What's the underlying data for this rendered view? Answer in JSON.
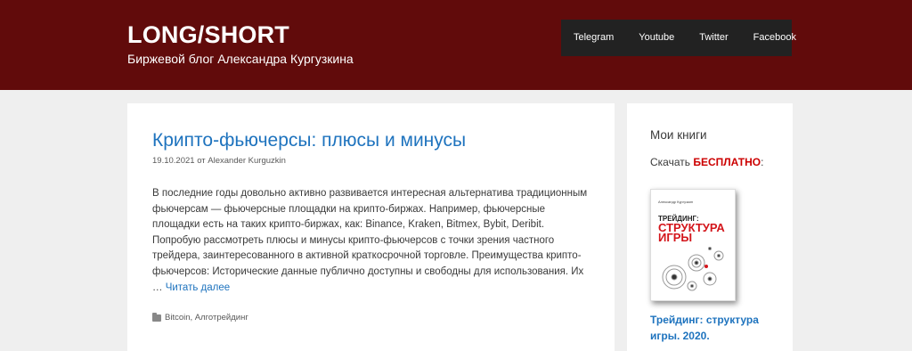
{
  "site": {
    "title": "LONG/SHORT",
    "description": "Биржевой блог Александра Кургузкина"
  },
  "nav": {
    "items": [
      "Telegram",
      "Youtube",
      "Twitter",
      "Facebook"
    ]
  },
  "post": {
    "title": "Крипто-фьючерсы: плюсы и минусы",
    "date": "19.10.2021",
    "by": "от",
    "author": "Alexander Kurguzkin",
    "excerpt": "В последние годы довольно активно развивается интересная альтернатива традиционным фьючерсам — фьючерсные площадки на крипто-биржах. Например, фьючерсные площадки есть на таких крипто-биржах, как: Binance, Kraken, Bitmex, Bybit, Deribit. Попробую рассмотреть плюсы и минусы крипто-фьючерсов с точки зрения частного трейдера, заинтересованного в активной краткосрочной торговле. Преимущества крипто-фьючерсов: Исторические данные публично доступны и свободны для использования. Их …",
    "read_more": "Читать далее",
    "categories": "Bitcoin, Алготрейдинг"
  },
  "sidebar": {
    "title": "Мои книги",
    "download_prefix": "Скачать",
    "download_free": "БЕСПЛАТНО",
    "download_suffix": ":",
    "book": {
      "author": "Александр Кургузкин",
      "title_pre": "ТРЕЙДИНГ:",
      "title_main": "СТРУКТУРА ИГРЫ"
    },
    "book_link": "Трейдинг: структура игры. 2020."
  },
  "colors": {
    "header_bg": "#610b0b",
    "link": "#1e73be",
    "accent_red": "#cc0000"
  }
}
